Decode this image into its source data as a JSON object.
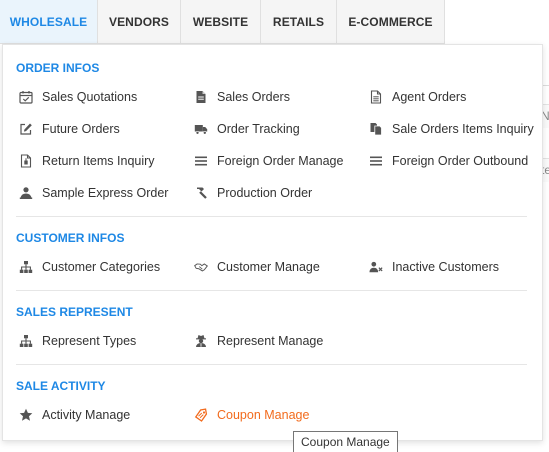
{
  "tabs": [
    {
      "label": "WHOLESALE"
    },
    {
      "label": "VENDORS"
    },
    {
      "label": "WEBSITE"
    },
    {
      "label": "RETAILS"
    },
    {
      "label": "E-COMMERCE"
    }
  ],
  "background": {
    "frag1": "",
    "frag2": "N",
    "frag3": "te"
  },
  "sections": {
    "order_infos": {
      "title": "ORDER INFOS",
      "items": [
        {
          "label": "Sales Quotations",
          "icon": "calendar-check-icon"
        },
        {
          "label": "Sales Orders",
          "icon": "file-icon"
        },
        {
          "label": "Agent Orders",
          "icon": "file-lines-icon"
        },
        {
          "label": "Future Orders",
          "icon": "edit-icon"
        },
        {
          "label": "Order Tracking",
          "icon": "truck-icon"
        },
        {
          "label": "Sale Orders Items Inquiry",
          "icon": "copy-icon"
        },
        {
          "label": "Return Items Inquiry",
          "icon": "file-return-icon"
        },
        {
          "label": "Foreign Order Manage",
          "icon": "list-icon"
        },
        {
          "label": "Foreign Order Outbound",
          "icon": "list-icon"
        },
        {
          "label": "Sample Express Order",
          "icon": "person-icon"
        },
        {
          "label": "Production Order",
          "icon": "hammer-icon"
        }
      ]
    },
    "customer_infos": {
      "title": "CUSTOMER INFOS",
      "items": [
        {
          "label": "Customer Categories",
          "icon": "sitemap-icon"
        },
        {
          "label": "Customer Manage",
          "icon": "handshake-icon"
        },
        {
          "label": "Inactive Customers",
          "icon": "user-times-icon"
        }
      ]
    },
    "sales_represent": {
      "title": "SALES REPRESENT",
      "items": [
        {
          "label": "Represent Types",
          "icon": "sitemap-icon"
        },
        {
          "label": "Represent Manage",
          "icon": "user-secret-icon"
        }
      ]
    },
    "sale_activity": {
      "title": "SALE ACTIVITY",
      "items": [
        {
          "label": "Activity Manage",
          "icon": "star-icon"
        },
        {
          "label": "Coupon Manage",
          "icon": "tag-icon"
        }
      ]
    }
  },
  "tooltip": {
    "text": "Coupon Manage"
  },
  "colors": {
    "accent": "#1e88e5",
    "highlight": "#f26b1d",
    "icon": "#555555"
  }
}
